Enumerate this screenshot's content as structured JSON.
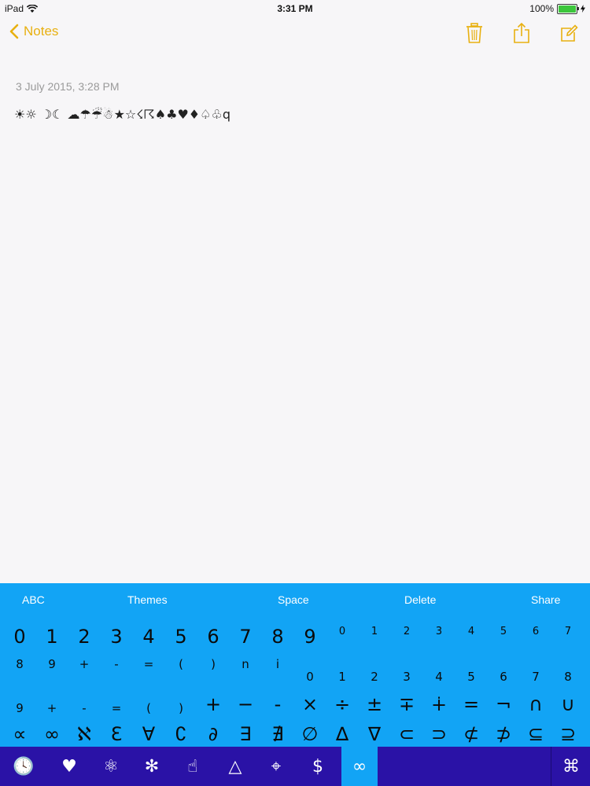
{
  "status_bar": {
    "device": "iPad",
    "time": "3:31 PM",
    "battery": "100%"
  },
  "nav": {
    "back_label": "Notes"
  },
  "note": {
    "date": "3 July 2015, 3:28 PM",
    "body": "☀☼ ☽☾ ☁☂☔☃★☆☇☈♠♣♥♦♤♧q"
  },
  "keyboard": {
    "toolbar": [
      "ABC",
      "Themes",
      "Space",
      "Delete",
      "Share"
    ],
    "row1_large": [
      "0",
      "1",
      "2",
      "3",
      "4",
      "5",
      "6",
      "7",
      "8",
      "9"
    ],
    "row1_super": [
      "0",
      "1",
      "2",
      "3",
      "4",
      "5",
      "6",
      "7"
    ],
    "row2_super": [
      "8",
      "9",
      "+",
      "-",
      "=",
      "(",
      ")",
      "n",
      "i"
    ],
    "row2_sub": [
      "0",
      "1",
      "2",
      "3",
      "4",
      "5",
      "6",
      "7",
      "8"
    ],
    "row3_sub": [
      "9",
      "+",
      "-",
      "=",
      "(",
      ")"
    ],
    "row3_ops": [
      "+",
      "−",
      "-",
      "×",
      "÷",
      "±",
      "∓",
      "∔",
      "=",
      "¬",
      "∩",
      "∪"
    ],
    "row4": [
      "∝",
      "∞",
      "ℵ",
      "Ɛ",
      "∀",
      "∁",
      "∂",
      "∃",
      "∄",
      "∅",
      "∆",
      "∇",
      "⊂",
      "⊃",
      "⊄",
      "⊅",
      "⊆",
      "⊇"
    ]
  },
  "categories": [
    {
      "icon": "clock-icon",
      "glyph": "🕓"
    },
    {
      "icon": "heart-icon",
      "glyph": "♥"
    },
    {
      "icon": "atom-icon",
      "glyph": "⚛"
    },
    {
      "icon": "asterisk-icon",
      "glyph": "✻"
    },
    {
      "icon": "hand-icon",
      "glyph": "☝"
    },
    {
      "icon": "triangle-icon",
      "glyph": "△"
    },
    {
      "icon": "crosshair-icon",
      "glyph": "⌖"
    },
    {
      "icon": "dollar-icon",
      "glyph": "$"
    },
    {
      "icon": "infinity-icon",
      "glyph": "∞"
    },
    {
      "icon": "command-icon",
      "glyph": "⌘"
    }
  ],
  "colors": {
    "accent": "#e8b010",
    "keyboard_bg": "#12a4f5",
    "category_bar_bg": "#2a12a6"
  }
}
